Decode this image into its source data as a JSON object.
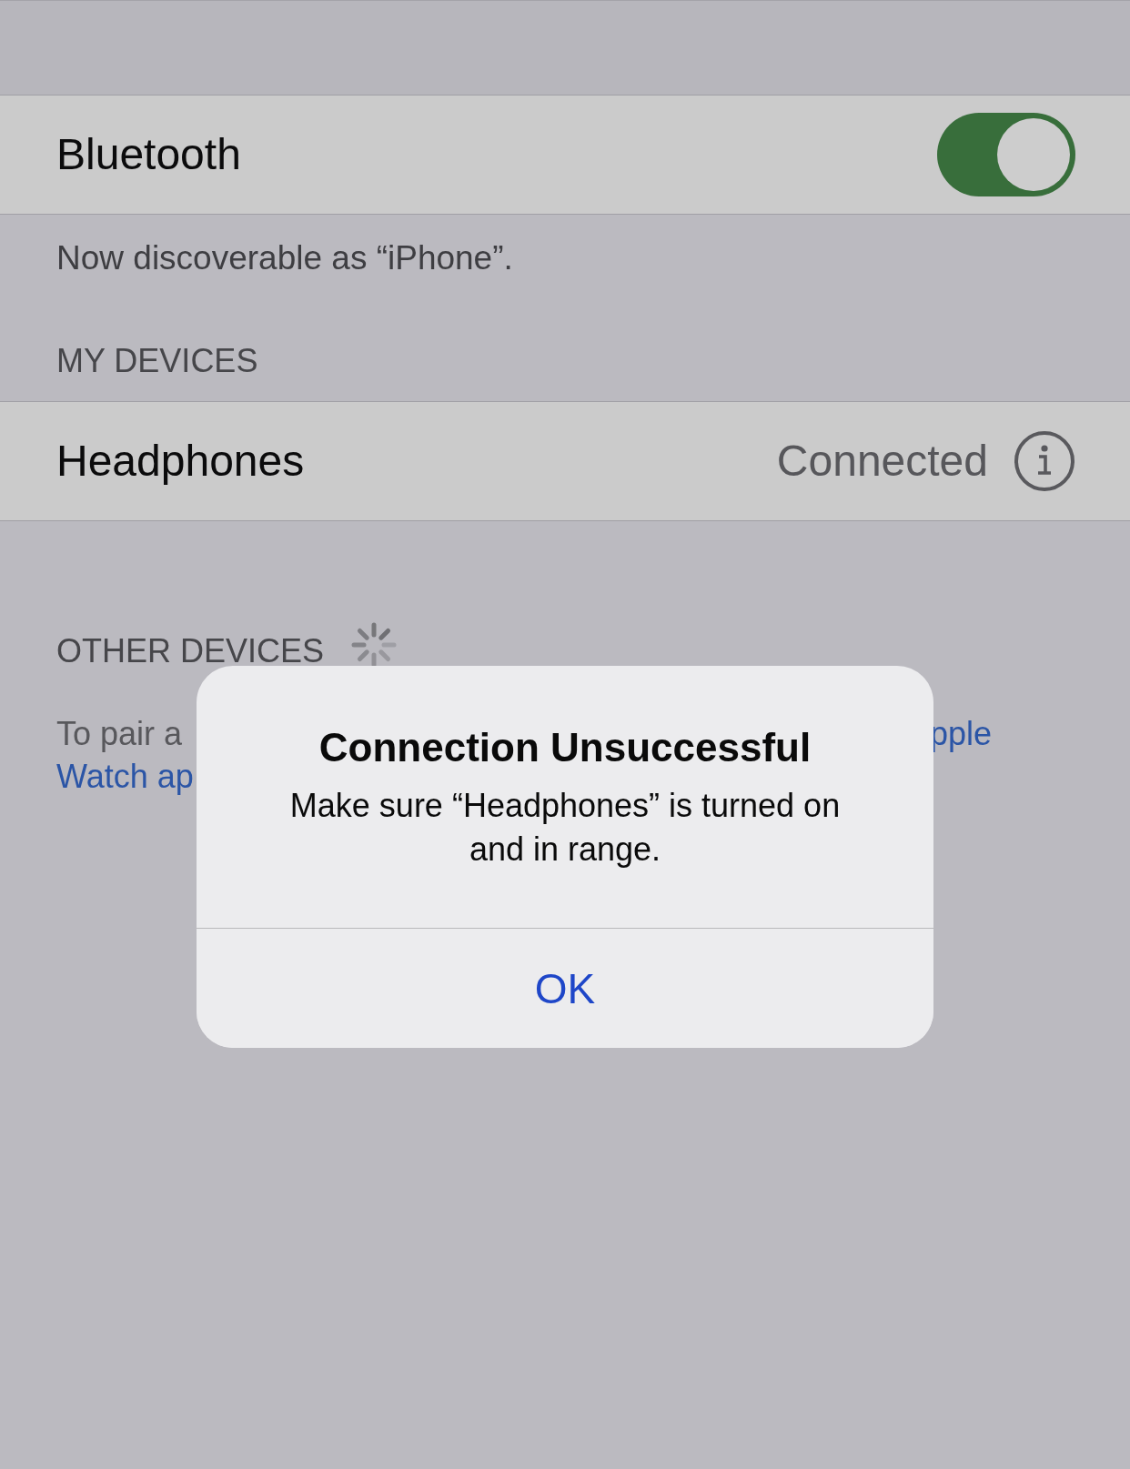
{
  "bluetooth": {
    "label": "Bluetooth",
    "on": true
  },
  "discoverable_note": "Now discoverable as “iPhone”.",
  "my_devices": {
    "header": "MY DEVICES",
    "devices": [
      {
        "name": "Headphones",
        "status": "Connected"
      }
    ]
  },
  "other_devices": {
    "header": "OTHER DEVICES",
    "searching": true,
    "pairing_note": [
      {
        "kind": "plain",
        "text": "To pair a"
      },
      {
        "kind": "link",
        "text": "pple"
      },
      {
        "kind": "link",
        "text": "Watch ap"
      }
    ]
  },
  "alert": {
    "title": "Connection Unsuccessful",
    "message": "Make sure “Headphones” is turned on and in range.",
    "buttons": [
      {
        "label": "OK"
      }
    ]
  }
}
